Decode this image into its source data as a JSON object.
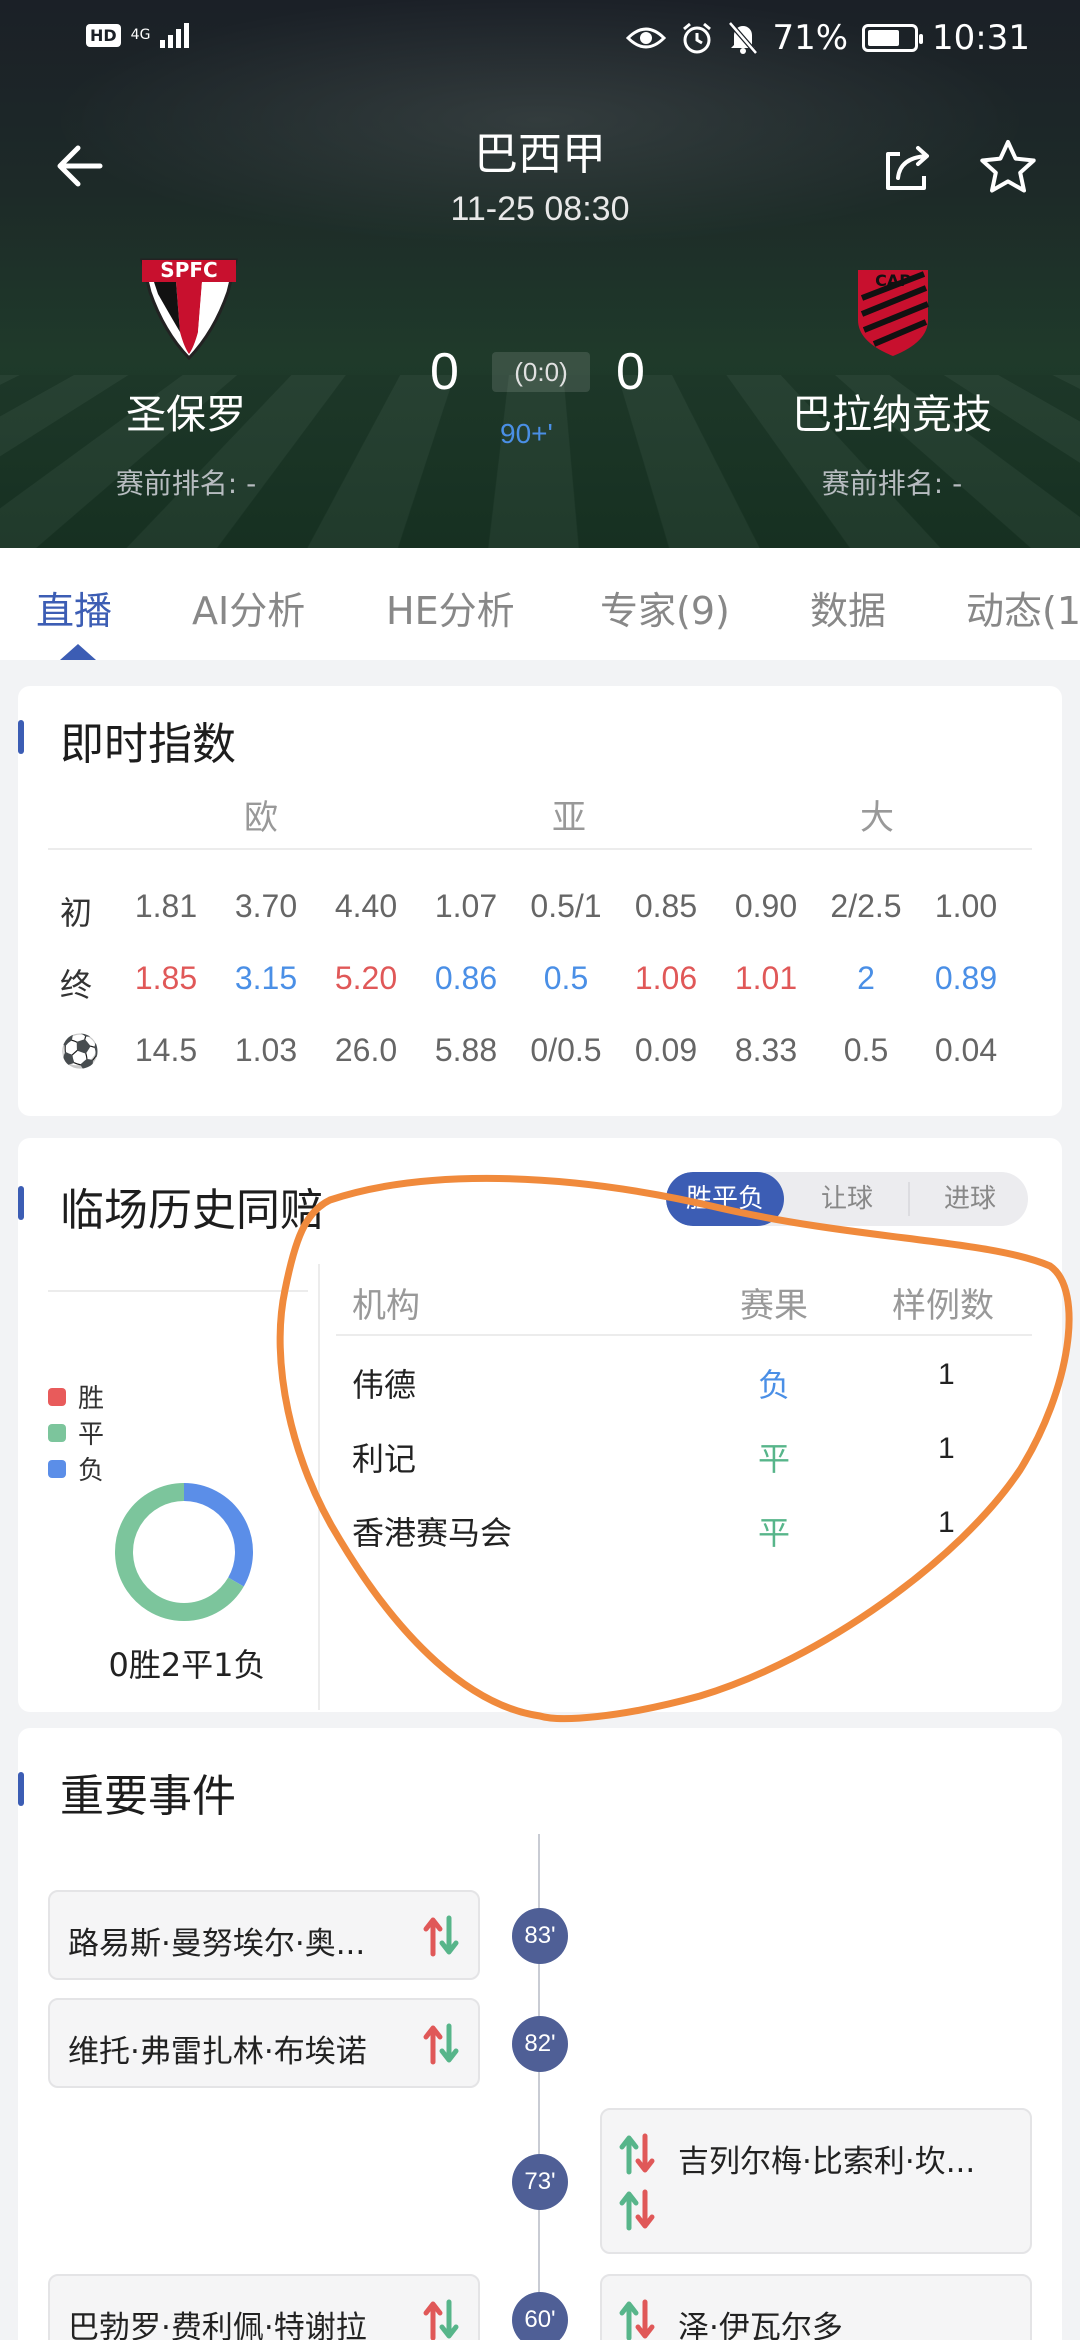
{
  "status_bar": {
    "hd": "HD",
    "network": "4G",
    "battery": "71%",
    "battery_level": 0.71,
    "time": "10:31"
  },
  "header": {
    "league": "巴西甲",
    "kickoff": "11-25 08:30",
    "home": {
      "name": "圣保罗",
      "rank": "赛前排名: -",
      "score": "0",
      "logo_text": "SPFC"
    },
    "away": {
      "name": "巴拉纳竞技",
      "rank": "赛前排名: -",
      "score": "0",
      "logo_text": "CAP"
    },
    "half_score": "(0:0)",
    "minute": "90+'"
  },
  "tabs": [
    "直播",
    "AI分析",
    "HE分析",
    "专家(9)",
    "数据",
    "动态(1"
  ],
  "odds": {
    "title": "即时指数",
    "groups": [
      "欧",
      "亚",
      "大"
    ],
    "rows": [
      {
        "label": "初",
        "values": [
          "1.81",
          "3.70",
          "4.40",
          "1.07",
          "0.5/1",
          "0.85",
          "0.90",
          "2/2.5",
          "1.00"
        ]
      },
      {
        "label": "终",
        "values": [
          "1.85",
          "3.15",
          "5.20",
          "0.86",
          "0.5",
          "1.06",
          "1.01",
          "2",
          "0.89"
        ]
      },
      {
        "label": "⚽",
        "values": [
          "14.5",
          "1.03",
          "26.0",
          "5.88",
          "0/0.5",
          "0.09",
          "8.33",
          "0.5",
          "0.04"
        ]
      }
    ]
  },
  "history": {
    "title": "临场历史同赔",
    "segments": [
      "胜平负",
      "让球",
      "进球"
    ],
    "legend": [
      "胜",
      "平",
      "负"
    ],
    "colors": {
      "win": "#e85b5b",
      "draw": "#7cc59c",
      "lose": "#5b8ee8"
    },
    "summary": "0胜2平1负",
    "counts": {
      "win": 0,
      "draw": 2,
      "lose": 1
    },
    "columns": [
      "机构",
      "赛果",
      "样例数"
    ],
    "rows": [
      {
        "org": "伟德",
        "result": "负",
        "count": "1"
      },
      {
        "org": "利记",
        "result": "平",
        "count": "1"
      },
      {
        "org": "香港赛马会",
        "result": "平",
        "count": "1"
      }
    ]
  },
  "events": {
    "title": "重要事件",
    "items": [
      {
        "minute": "83'",
        "side": "home",
        "text": "路易斯·曼努埃尔·奥..."
      },
      {
        "minute": "82'",
        "side": "home",
        "text": "维托·弗雷扎林·布埃诺"
      },
      {
        "minute": "73'",
        "side": "away",
        "text": "吉列尔梅·比索利·坎..."
      },
      {
        "minute": "60'",
        "side": "home",
        "text": "巴勃罗·费利佩·特谢拉"
      },
      {
        "minute": "60'",
        "side": "away",
        "text": "泽·伊瓦尔多"
      }
    ]
  }
}
